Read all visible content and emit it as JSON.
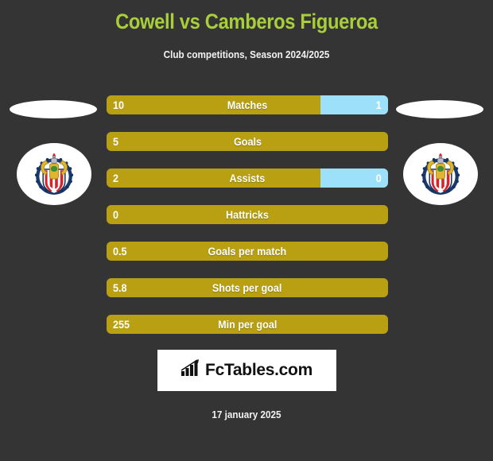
{
  "header": {
    "title": "Cowell vs Camberos Figueroa",
    "subtitle": "Club competitions, Season 2024/2025"
  },
  "colors": {
    "background": "#343434",
    "title": "#a8ce3a",
    "home_bar": "#b8a012",
    "away_bar": "#9ce0fa",
    "text": "#ffffff"
  },
  "left_player": {
    "photo": "player-photo-placeholder",
    "club_crest": "chivas-guadalajara-crest"
  },
  "right_player": {
    "photo": "player-photo-placeholder",
    "club_crest": "chivas-guadalajara-crest"
  },
  "stats": [
    {
      "label": "Matches",
      "home": "10",
      "away": "1",
      "home_pct": 76,
      "away_pct": 24,
      "has_away": true
    },
    {
      "label": "Goals",
      "home": "5",
      "away": "",
      "home_pct": 100,
      "away_pct": 0,
      "has_away": false
    },
    {
      "label": "Assists",
      "home": "2",
      "away": "0",
      "home_pct": 76,
      "away_pct": 24,
      "has_away": true
    },
    {
      "label": "Hattricks",
      "home": "0",
      "away": "",
      "home_pct": 100,
      "away_pct": 0,
      "has_away": false
    },
    {
      "label": "Goals per match",
      "home": "0.5",
      "away": "",
      "home_pct": 100,
      "away_pct": 0,
      "has_away": false
    },
    {
      "label": "Shots per goal",
      "home": "5.8",
      "away": "",
      "home_pct": 100,
      "away_pct": 0,
      "has_away": false
    },
    {
      "label": "Min per goal",
      "home": "255",
      "away": "",
      "home_pct": 100,
      "away_pct": 0,
      "has_away": false
    }
  ],
  "footer": {
    "logo_text": "FcTables.com",
    "logo_icon": "bar-chart-growth-icon",
    "date": "17 january 2025"
  }
}
